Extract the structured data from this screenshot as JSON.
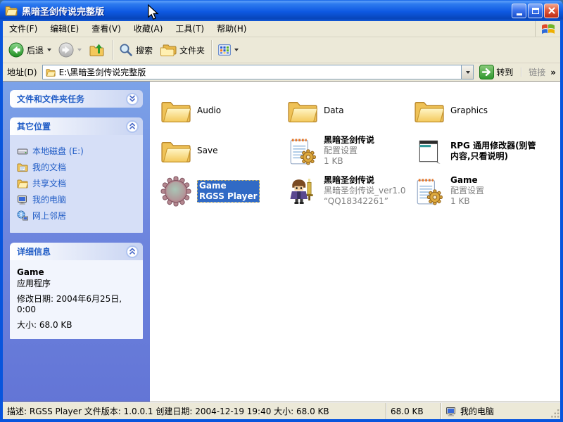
{
  "window": {
    "title": "黑暗圣剑传说完整版"
  },
  "menu": {
    "items": [
      "文件(F)",
      "编辑(E)",
      "查看(V)",
      "收藏(A)",
      "工具(T)",
      "帮助(H)"
    ]
  },
  "toolbar": {
    "back_label": "后退",
    "search_label": "搜索",
    "folders_label": "文件夹"
  },
  "address": {
    "label": "地址(D)",
    "value": "E:\\黑暗圣剑传说完整版",
    "go_label": "转到",
    "links_label": "链接",
    "overflow_glyph": "»"
  },
  "sidebar": {
    "tasks_title": "文件和文件夹任务",
    "other_places": {
      "title": "其它位置",
      "items": [
        {
          "label": "本地磁盘 (E:)"
        },
        {
          "label": "我的文档"
        },
        {
          "label": "共享文档"
        },
        {
          "label": "我的电脑"
        },
        {
          "label": "网上邻居"
        }
      ]
    },
    "details": {
      "title": "详细信息",
      "name": "Game",
      "type": "应用程序",
      "modified": "修改日期: 2004年6月25日, 0:00",
      "size": "大小: 68.0 KB"
    }
  },
  "files": [
    {
      "name": "Audio",
      "type": "folder"
    },
    {
      "name": "Data",
      "type": "folder"
    },
    {
      "name": "Graphics",
      "type": "folder"
    },
    {
      "name": "Save",
      "type": "folder"
    },
    {
      "name": "黑暗圣剑传说",
      "line2": "配置设置",
      "line3": "1 KB",
      "type": "config"
    },
    {
      "name": "RPG 通用修改器(别管内容,只看说明)",
      "type": "text"
    },
    {
      "name": "Game",
      "line2": "RGSS Player",
      "selected": true,
      "type": "application"
    },
    {
      "name": "黑暗圣剑传说",
      "line2": "黑暗圣剑传说_ver1.0",
      "line3": "“QQ18342261”",
      "type": "game-exe"
    },
    {
      "name": "Game",
      "line2": "配置设置",
      "line3": "1 KB",
      "type": "config"
    }
  ],
  "statusbar": {
    "description": "描述: RGSS Player 文件版本: 1.0.0.1 创建日期: 2004-12-19 19:40 大小: 68.0 KB",
    "size": "68.0 KB",
    "location": "我的电脑"
  },
  "colors": {
    "selection": "#316AC5",
    "window_border": "#0855DD",
    "sidebar_link": "#215DC6",
    "titlebar_blue": "#0E59E2"
  }
}
